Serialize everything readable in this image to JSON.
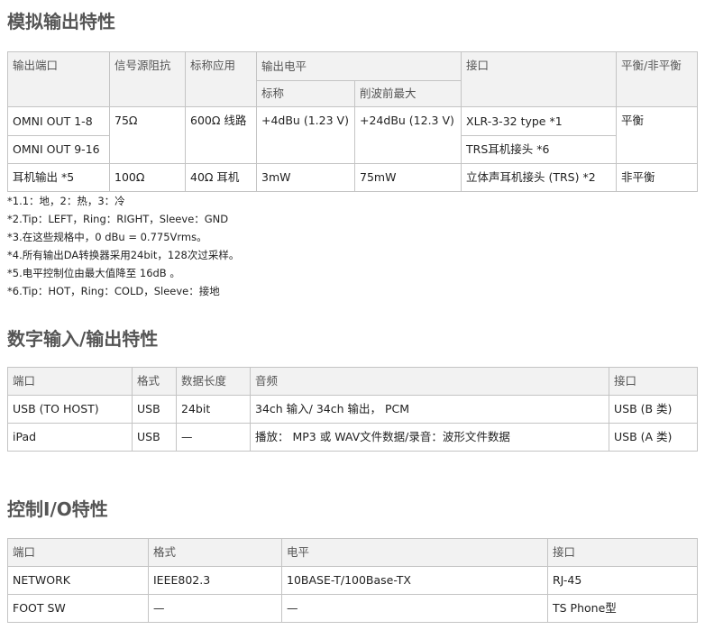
{
  "analog": {
    "title": "模拟输出特性",
    "header": {
      "port": "输出端口",
      "source_impedance": "信号源阻抗",
      "nominal_impedance": "标称应用",
      "level": "输出电平",
      "level_nominal": "标称",
      "level_max": "削波前最大",
      "connector": "接口",
      "balance": "平衡/非平衡"
    },
    "rows": [
      {
        "port": "OMNI OUT 1-8",
        "impedance": "75Ω",
        "nominal": "600Ω 线路",
        "level_nominal": "+4dBu (1.23 V)",
        "level_max": "+24dBu (12.3 V)",
        "connector": "XLR-3-32 type *1",
        "balance": "平衡"
      },
      {
        "port": "OMNI OUT 9-16",
        "connector": "TRS耳机接头 *6"
      },
      {
        "port": "耳机输出 *5",
        "impedance": "100Ω",
        "nominal": "40Ω 耳机",
        "level_nominal": "3mW",
        "level_max": "75mW",
        "connector": "立体声耳机接头 (TRS) *2",
        "balance": "非平衡"
      }
    ],
    "notes": [
      "*1.1：地，2：热，3：冷",
      "*2.Tip：LEFT，Ring：RIGHT，Sleeve：GND",
      "*3.在这些规格中，0 dBu = 0.775Vrms。",
      "*4.所有输出DA转换器采用24bit，128次过采样。",
      "*5.电平控制位由最大值降至 16dB 。",
      "*6.Tip：HOT，Ring：COLD，Sleeve：接地"
    ]
  },
  "digital": {
    "title": "数字输入/输出特性",
    "header": {
      "port": "端口",
      "format": "格式",
      "data_length": "数据长度",
      "audio": "音频",
      "connector": "接口"
    },
    "rows": [
      {
        "port": "USB (TO HOST)",
        "format": "USB",
        "data_length": "24bit",
        "audio": "34ch 输入/ 34ch 输出， PCM",
        "connector": "USB (B 类)"
      },
      {
        "port": "iPad",
        "format": "USB",
        "data_length": "—",
        "audio": "播放： MP3 或 WAV文件数据/录音：波形文件数据",
        "connector": "USB (A 类)"
      }
    ]
  },
  "control": {
    "title": "控制I/O特性",
    "header": {
      "port": "端口",
      "format": "格式",
      "level": "电平",
      "connector": "接口"
    },
    "rows": [
      {
        "port": "NETWORK",
        "format": "IEEE802.3",
        "level": "10BASE-T/100Base-TX",
        "connector": "RJ-45"
      },
      {
        "port": "FOOT SW",
        "format": "—",
        "level": "—",
        "connector": "TS Phone型"
      }
    ]
  }
}
